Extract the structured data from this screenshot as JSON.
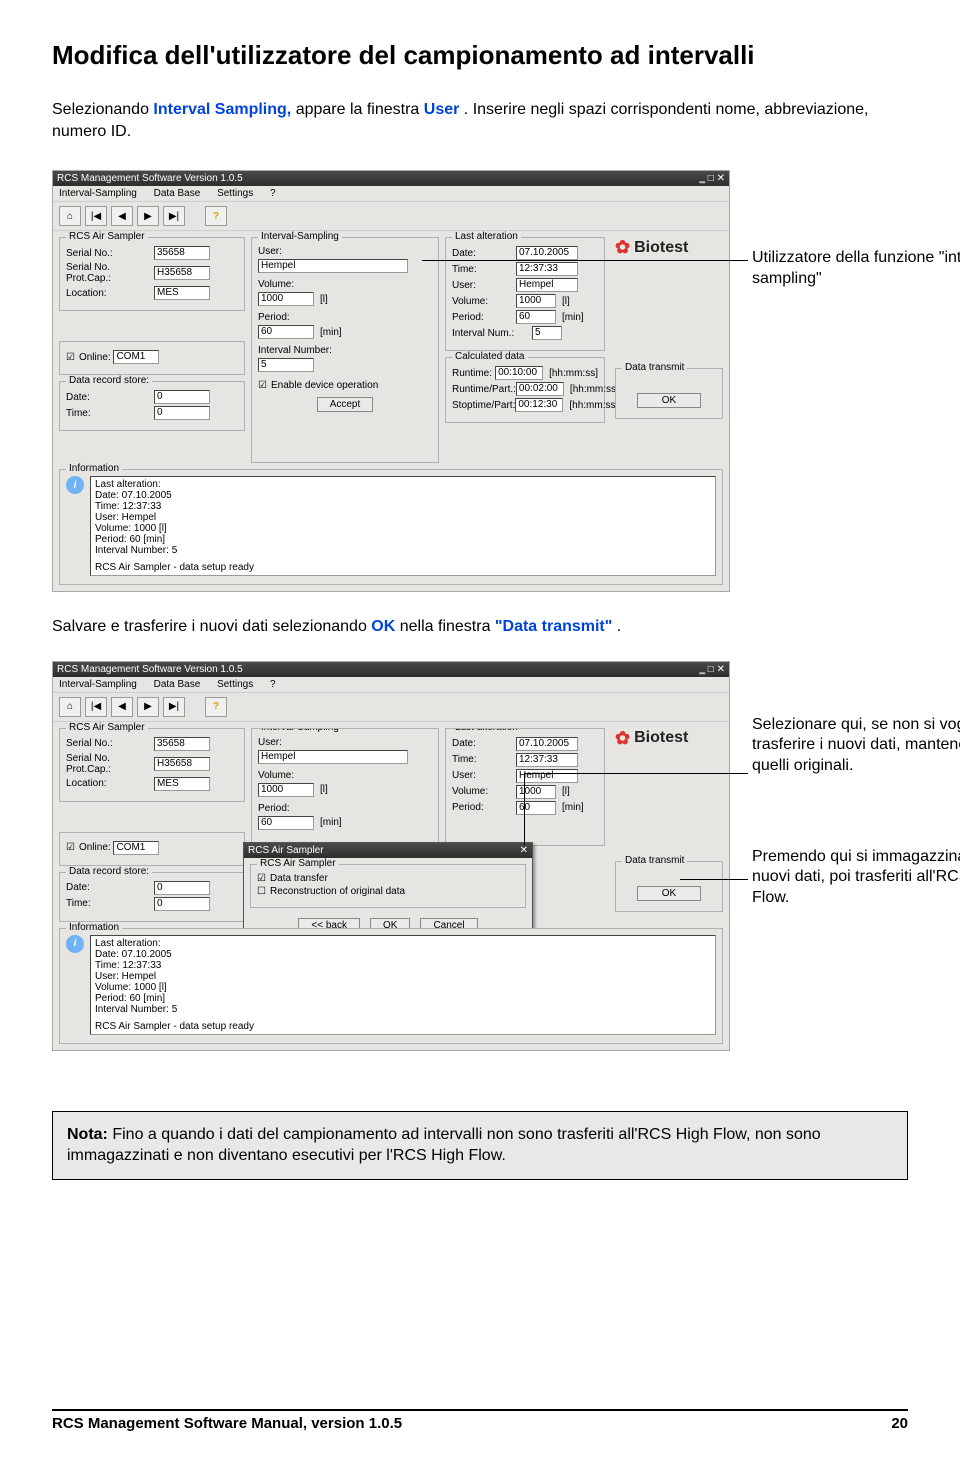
{
  "heading": "Modifica dell'utilizzatore del campionamento ad intervalli",
  "intro": {
    "a": "Selezionando ",
    "b": "Interval Sampling,",
    "c": " appare la finestra ",
    "d": "User",
    "e": ". Inserire negli spazi corrispondenti nome, abbreviazione, numero ID."
  },
  "win": {
    "title": "RCS Management Software Version 1.0.5",
    "menu": {
      "a": "Interval-Sampling",
      "b": "Data Base",
      "c": "Settings",
      "d": "?"
    },
    "toolbar_nav": [
      "|◀",
      "◀",
      "▶",
      "▶|"
    ],
    "help_icon": "?"
  },
  "gs": {
    "air": "RCS Air Sampler",
    "serial": "Serial No.:",
    "serial_v": "35658",
    "prot": "Serial No. Prot.Cap.:",
    "prot_v": "H35658",
    "loc": "Location:",
    "loc_v": "MES",
    "online": "Online:",
    "online_v": "COM1",
    "drs": "Data record store:",
    "date": "Date:",
    "date_v": "0",
    "time": "Time:",
    "time_v": "0",
    "is": "Interval-Sampling",
    "user": "User:",
    "user_v": "Hempel",
    "vol": "Volume:",
    "vol_v": "1000",
    "vol_u": "[l]",
    "per": "Period:",
    "per_v": "60",
    "per_u": "[min]",
    "in": "Interval Number:",
    "in_v": "5",
    "en": "Enable device operation",
    "accept": "Accept",
    "la": "Last alteration",
    "la_date": "07.10.2005",
    "la_time": "12:37:33",
    "la_user": "Hempel",
    "la_vol": "1000",
    "la_per": "60",
    "la_in": "5",
    "cd": "Calculated data",
    "rt": "Runtime:",
    "rt_v": "00:10:00",
    "hms": "[hh:mm:ss]",
    "rtp": "Runtime/Part.:",
    "rtp_v": "00:02:00",
    "stp": "Stoptime/Part:",
    "stp_v": "00:12:30",
    "dt": "Data transmit",
    "ok": "OK",
    "info": "Information",
    "info_title": "Last alteration:",
    "info_lines": "Date: 07.10.2005\nTime: 12:37:33\nUser: Hempel\nVolume: 1000 [l]\nPeriod: 60 [min]\nInterval Number: 5",
    "info_status": "RCS Air Sampler - data setup ready",
    "brand": "Biotest"
  },
  "callouts": {
    "c1": "Utilizzatore della funzione \"interval sampling\"",
    "c2": "Selezionare qui, se non si vogliono trasferire i nuovi dati, mantenendo quelli originali.",
    "c3": "Premendo qui si immagazzinano i nuovi dati, poi trasferiti all'RCS High Flow."
  },
  "mid": {
    "a": "Salvare e trasferire i nuovi dati selezionando ",
    "ok": "OK",
    "b": " nella finestra ",
    "dt": "\"Data transmit\"",
    "c": "."
  },
  "dialog": {
    "title": "RCS Air Sampler",
    "gbox": "RCS Air Sampler",
    "opt1": "Data transfer",
    "opt2": "Reconstruction of original data",
    "back": "<< back",
    "ok": "OK",
    "cancel": "Cancel"
  },
  "note": {
    "label": "Nota:",
    "text": " Fino a quando i dati del campionamento ad intervalli non sono trasferiti all'RCS High Flow, non sono immagazzinati e non diventano esecutivi per l'RCS High Flow."
  },
  "footer": {
    "left": "RCS Management Software Manual, version 1.0.5",
    "right": "20"
  }
}
